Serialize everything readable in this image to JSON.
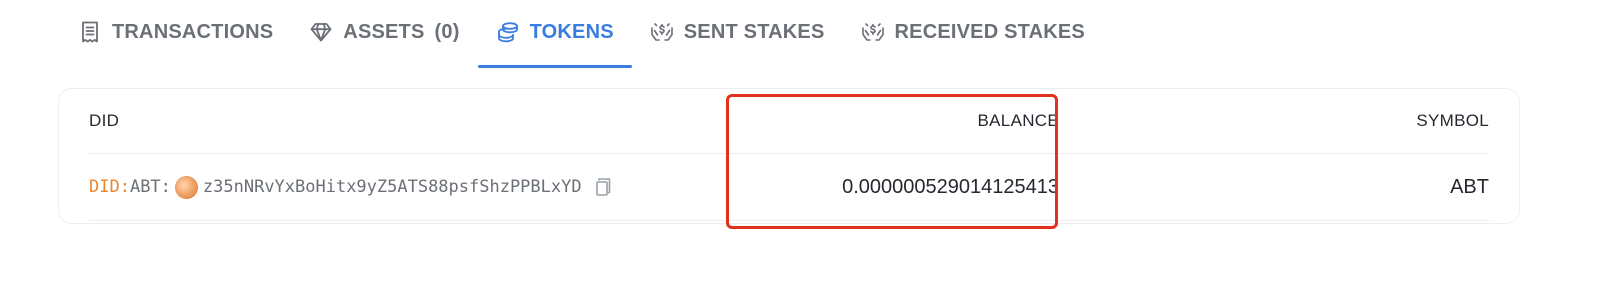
{
  "tabs": [
    {
      "label": "TRANSACTIONS",
      "icon": "receipt-icon",
      "active": false
    },
    {
      "label": "ASSETS",
      "count": "(0)",
      "icon": "diamond-icon",
      "active": false
    },
    {
      "label": "TOKENS",
      "icon": "coins-icon",
      "active": true
    },
    {
      "label": "SENT STAKES",
      "icon": "hand-stake-icon",
      "active": false
    },
    {
      "label": "RECEIVED STAKES",
      "icon": "hand-stake-icon",
      "active": false
    }
  ],
  "colors": {
    "accent": "#3a7de0",
    "tab_inactive": "#6b6f76",
    "did_prefix": "#e9862b",
    "highlight": "#e2321d"
  },
  "table": {
    "headers": {
      "did": "DID",
      "balance": "BALANCE",
      "symbol": "SYMBOL"
    },
    "rows": [
      {
        "did_prefix": "DID:",
        "did_type": "ABT:",
        "did_address": "z35nNRvYxBoHitx9yZ5ATS88psfShzPPBLxYD",
        "balance": "0.000000529014125413",
        "symbol": "ABT"
      }
    ]
  }
}
